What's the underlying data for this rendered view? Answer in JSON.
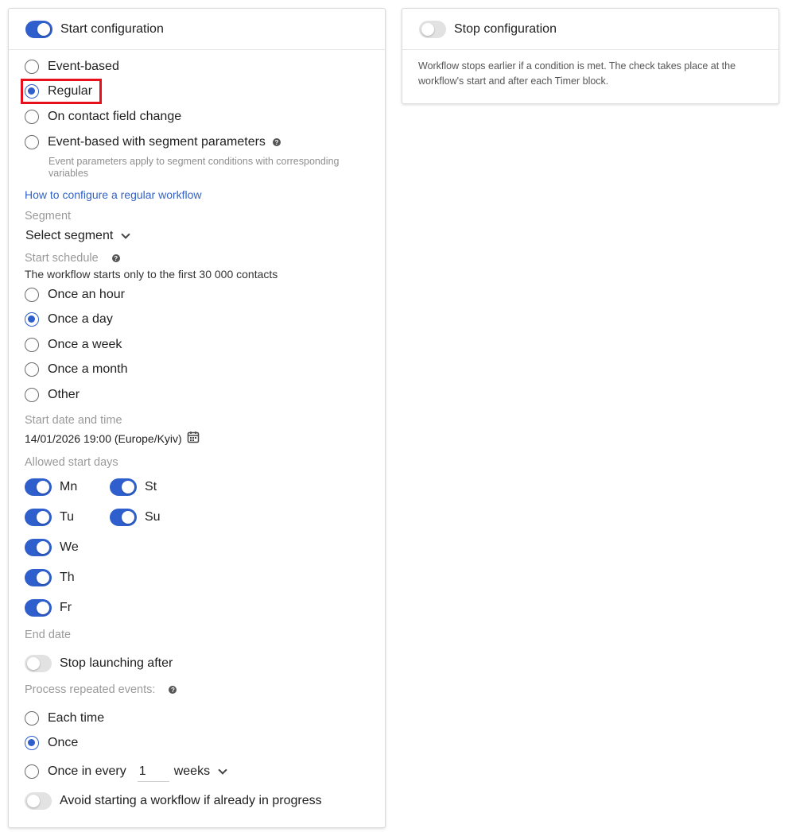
{
  "start_card": {
    "header": {
      "title": "Start configuration",
      "enabled": true
    },
    "trigger_options": [
      {
        "label": "Event-based",
        "checked": false
      },
      {
        "label": "Regular",
        "checked": true
      },
      {
        "label": "On contact field change",
        "checked": false
      },
      {
        "label": "Event-based with segment parameters",
        "checked": false
      }
    ],
    "segment_params_hint_line1": "Event parameters apply to segment conditions with corresponding",
    "segment_params_hint_line2": "variables",
    "help_link": "How to configure a regular workflow",
    "segment": {
      "label": "Segment",
      "value": "Select segment"
    },
    "schedule": {
      "label": "Start schedule",
      "hint": "The workflow starts only to the first 30 000 contacts",
      "options": [
        {
          "label": "Once an hour",
          "checked": false
        },
        {
          "label": "Once a day",
          "checked": true
        },
        {
          "label": "Once a week",
          "checked": false
        },
        {
          "label": "Once a month",
          "checked": false
        },
        {
          "label": "Other",
          "checked": false
        }
      ]
    },
    "start_datetime": {
      "label": "Start date and time",
      "value": "14/01/2026 19:00 (Europe/Kyiv)"
    },
    "allowed_days": {
      "label": "Allowed start days",
      "days": [
        {
          "label": "Mn",
          "enabled": true
        },
        {
          "label": "Tu",
          "enabled": true
        },
        {
          "label": "We",
          "enabled": true
        },
        {
          "label": "Th",
          "enabled": true
        },
        {
          "label": "Fr",
          "enabled": true
        },
        {
          "label": "St",
          "enabled": true
        },
        {
          "label": "Su",
          "enabled": true
        }
      ]
    },
    "end_date": {
      "label": "End date",
      "stop_label": "Stop launching after",
      "enabled": false
    },
    "repeated_events": {
      "label": "Process repeated events:",
      "options": [
        {
          "label": "Each time",
          "checked": false
        },
        {
          "label": "Once",
          "checked": true
        },
        {
          "label": "Once in every",
          "checked": false
        }
      ],
      "interval_value": "1",
      "interval_unit": "weeks"
    },
    "avoid_in_progress": {
      "label": "Avoid starting a workflow if already in progress",
      "enabled": false
    }
  },
  "stop_card": {
    "header": {
      "title": "Stop configuration",
      "enabled": false
    },
    "description_line1": "Workflow stops earlier if a condition is met. The check takes place at the",
    "description_line2": "workflow's start and after each Timer block."
  },
  "colors": {
    "accent": "#2f5fcc",
    "highlight": "#e8101d",
    "link": "#3463c8"
  }
}
